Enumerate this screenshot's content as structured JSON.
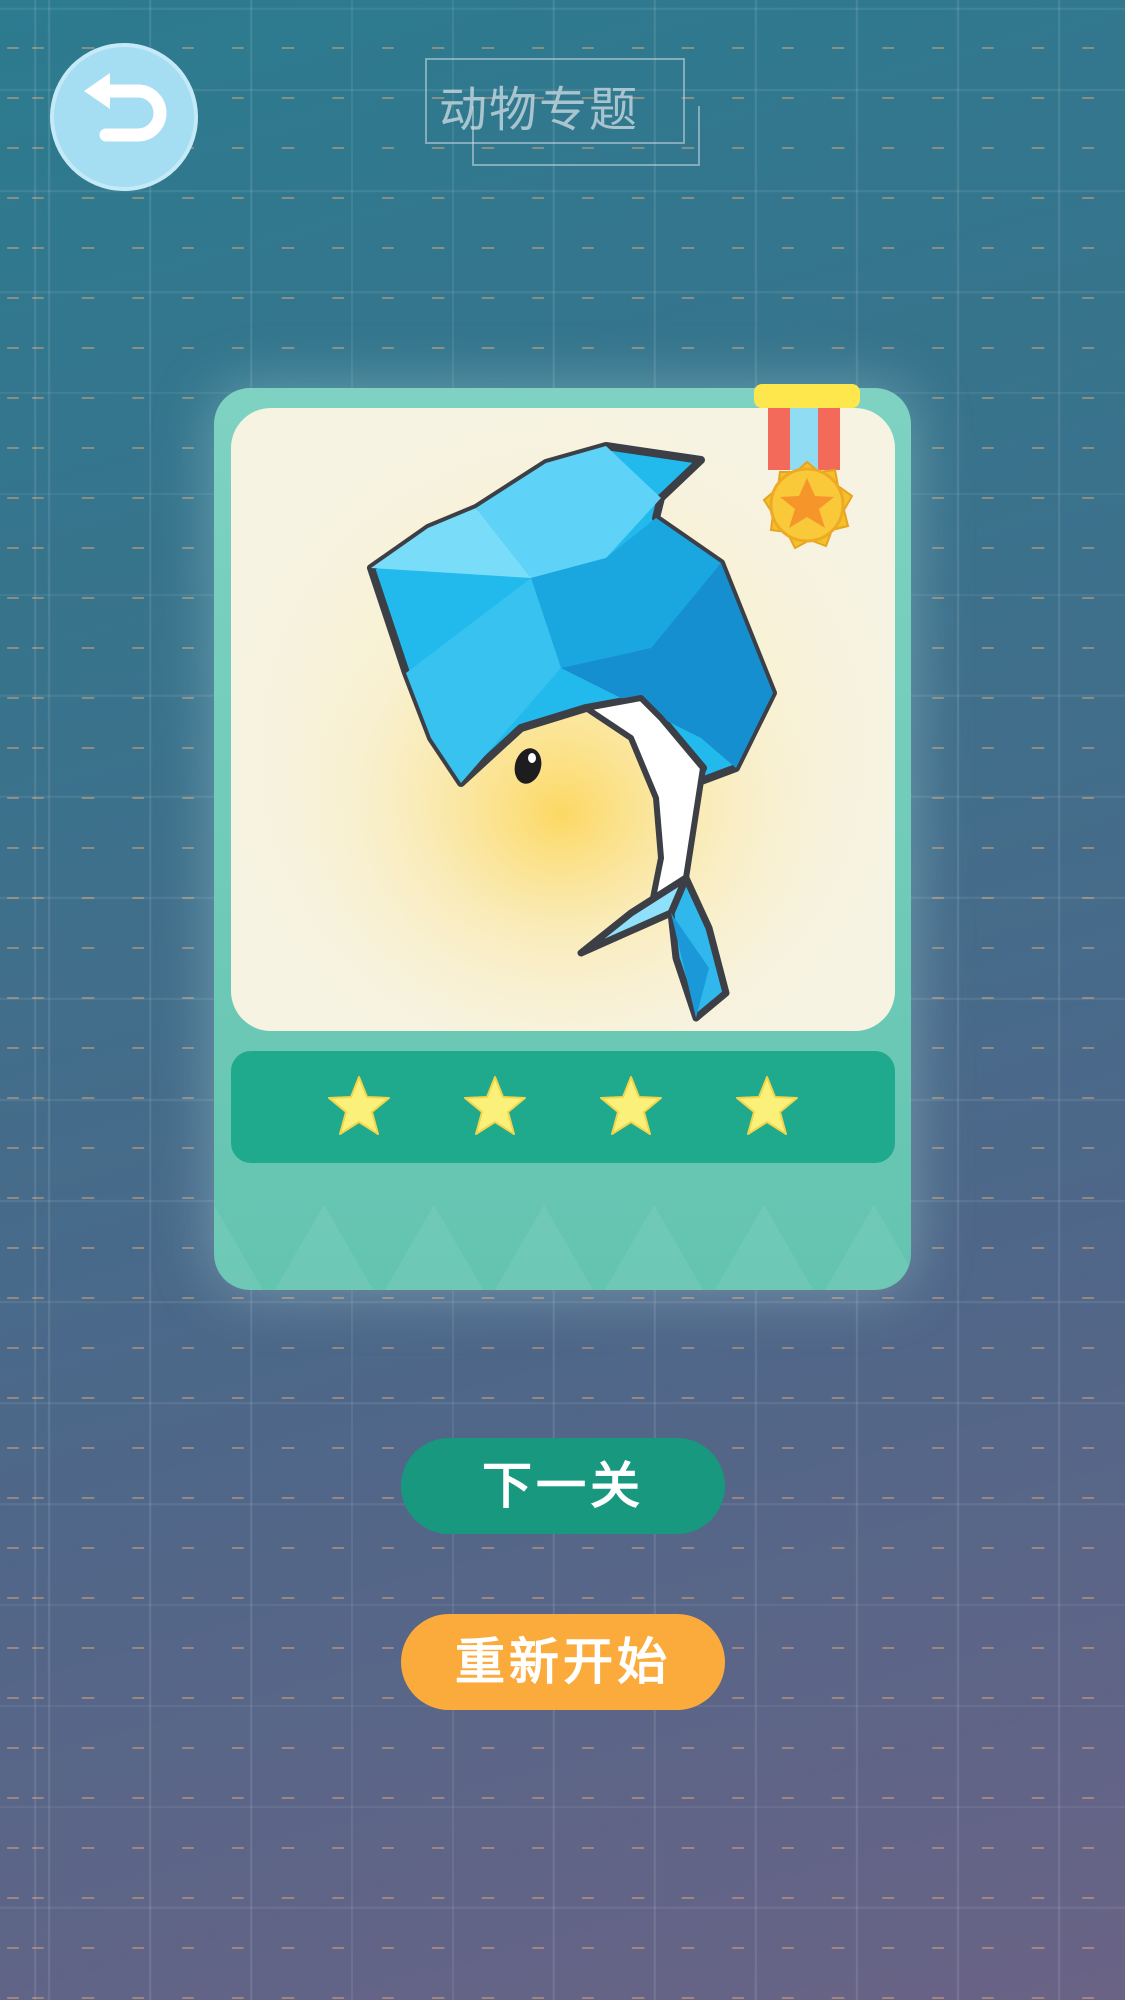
{
  "header": {
    "title": "动物专题"
  },
  "level_card": {
    "animal_icon": "dolphin-picture",
    "medal_icon": "gold-medal-icon",
    "stars_earned": 4,
    "stars_total": 4
  },
  "buttons": {
    "next_label": "下一关",
    "restart_label": "重新开始"
  },
  "colors": {
    "card_green": "#6ecab7",
    "star_bar": "#1fa98d",
    "next_button": "#17987f",
    "restart_button": "#fbab3c",
    "back_button": "#a5ddf3"
  }
}
